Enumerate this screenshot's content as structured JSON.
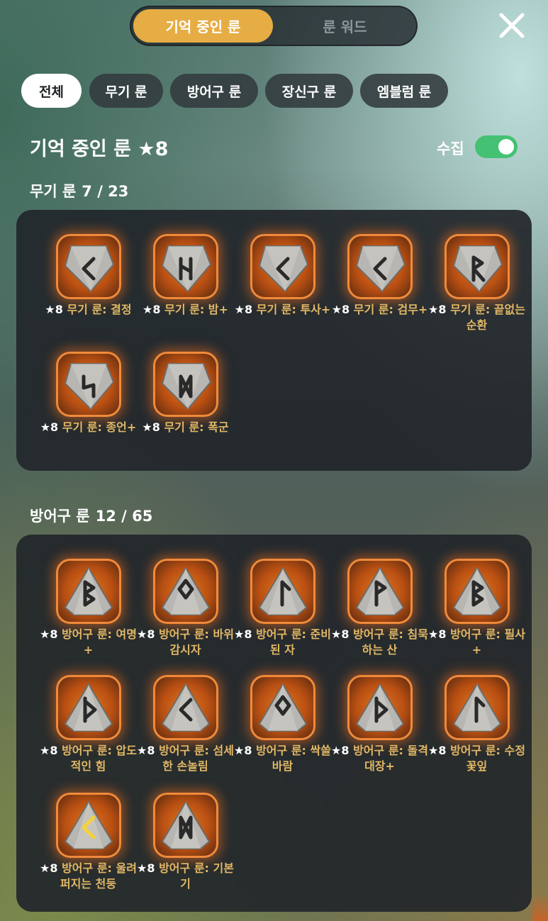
{
  "top_tabs": {
    "active": "기억 중인 룬",
    "inactive": "룬 워드"
  },
  "filters": [
    "전체",
    "무기 룬",
    "방어구 룬",
    "장신구 룬",
    "엠블럼 룬"
  ],
  "header": {
    "title": "기억 중인 룬 ★8",
    "collect_label": "수집",
    "collect_on": true
  },
  "weapon": {
    "title": "무기 룬",
    "count": "7 / 23",
    "items": [
      {
        "star": "★8",
        "name": "무기 룬: 결정",
        "glyph": "kaun"
      },
      {
        "star": "★8",
        "name": "무기 룬: 밤+",
        "glyph": "hagalaz"
      },
      {
        "star": "★8",
        "name": "무기 룬: 투사+",
        "glyph": "kaun"
      },
      {
        "star": "★8",
        "name": "무기 룬: 검무+",
        "glyph": "kaun"
      },
      {
        "star": "★8",
        "name": "무기 룬: 끝없는 순환",
        "glyph": "raido"
      },
      {
        "star": "★8",
        "name": "무기 룬: 종언+",
        "glyph": "sowilo"
      },
      {
        "star": "★8",
        "name": "무기 룬: 폭군",
        "glyph": "dagaz"
      }
    ]
  },
  "armor": {
    "title": "방어구 룬",
    "count": "12 / 65",
    "items": [
      {
        "star": "★8",
        "name": "방어구 룬: 여명+",
        "glyph": "berkano"
      },
      {
        "star": "★8",
        "name": "방어구 룬: 바위 감시자",
        "glyph": "othala"
      },
      {
        "star": "★8",
        "name": "방어구 룬: 준비된 자",
        "glyph": "laguz"
      },
      {
        "star": "★8",
        "name": "방어구 룬: 침묵하는 산",
        "glyph": "wunjo"
      },
      {
        "star": "★8",
        "name": "방어구 룬: 필사+",
        "glyph": "berkano"
      },
      {
        "star": "★8",
        "name": "방어구 룬: 압도적인 힘",
        "glyph": "thurisaz"
      },
      {
        "star": "★8",
        "name": "방어구 룬: 섬세한 손놀림",
        "glyph": "kaun"
      },
      {
        "star": "★8",
        "name": "방어구 룬: 싹쓸바람",
        "glyph": "othala"
      },
      {
        "star": "★8",
        "name": "방어구 룬: 돌격대장+",
        "glyph": "thurisaz"
      },
      {
        "star": "★8",
        "name": "방어구 룬: 수정 꽃잎",
        "glyph": "laguz"
      },
      {
        "star": "★8",
        "name": "방어구 룬: 울려퍼지는 천둥",
        "glyph": "kaun-gold"
      },
      {
        "star": "★8",
        "name": "방어구 룬: 기본기",
        "glyph": "dagaz"
      }
    ]
  }
}
